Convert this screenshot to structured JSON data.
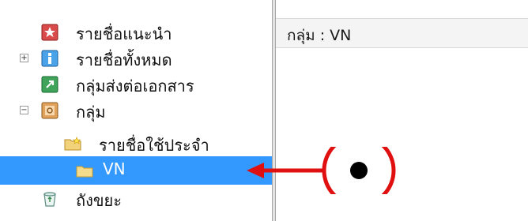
{
  "tree": {
    "items": [
      {
        "label": "รายชื่อแนะนำ",
        "icon": "recommended-contacts-icon",
        "expander": ""
      },
      {
        "label": "รายชื่อทั้งหมด",
        "icon": "all-contacts-icon",
        "expander": "+"
      },
      {
        "label": "กลุ่มส่งต่อเอกสาร",
        "icon": "document-forward-group-icon",
        "expander": ""
      },
      {
        "label": "กลุ่ม",
        "icon": "groups-icon",
        "expander": "−"
      },
      {
        "label": "รายชื่อใช้ประจำ",
        "icon": "frequent-contacts-folder-icon",
        "expander": ""
      },
      {
        "label": "VN",
        "icon": "folder-icon",
        "expander": "",
        "selected": true
      },
      {
        "label": "ถังขยะ",
        "icon": "trash-icon",
        "expander": ""
      }
    ]
  },
  "pane": {
    "title": "กลุ่ม : VN"
  },
  "colors": {
    "selection": "#3399ff",
    "annotation": "#e01010"
  }
}
